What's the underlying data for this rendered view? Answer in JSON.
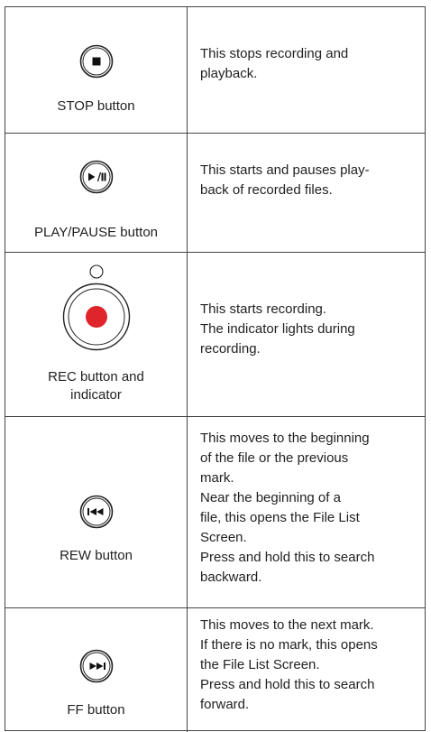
{
  "rows": [
    {
      "label": "STOP button",
      "lines": [
        "This stops recording and",
        "playback."
      ]
    },
    {
      "label": "PLAY/PAUSE button",
      "lines": [
        "This starts and pauses play-",
        "back of recorded files."
      ]
    },
    {
      "label_lines": [
        "REC button and",
        "indicator"
      ],
      "lines": [
        "This starts recording.",
        "The indicator lights during",
        "recording."
      ]
    },
    {
      "label": "REW button",
      "lines": [
        "This moves to the beginning",
        "of the file or the previous",
        "mark.",
        "Near the beginning of a",
        "file, this opens the File List",
        "Screen.",
        "Press and hold this to search",
        "backward."
      ]
    },
    {
      "label": "FF button",
      "lines": [
        "This moves to the next mark.",
        "If there is no mark, this opens",
        "the File List Screen.",
        "Press and hold this to search",
        "forward."
      ]
    }
  ],
  "colors": {
    "rec": "#e0242b",
    "border": "#444444",
    "text": "#222222"
  },
  "icons": [
    "stop-icon",
    "play-pause-icon",
    "rec-icon",
    "rew-icon",
    "ff-icon"
  ]
}
